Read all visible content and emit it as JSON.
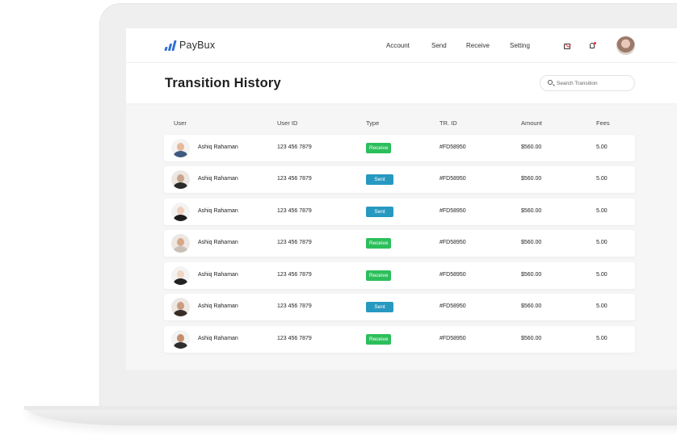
{
  "app": {
    "name": "PayBux",
    "nav": {
      "account": "Account",
      "send": "Send",
      "receive": "Receive",
      "setting": "Setting"
    },
    "icons": [
      "bar-chart-logo-icon",
      "mail-icon",
      "bell-icon"
    ]
  },
  "page": {
    "title": "Transition History",
    "search_placeholder": "Search Transition"
  },
  "table": {
    "columns": [
      "User",
      "User ID",
      "Type",
      "TR. ID",
      "Amount",
      "Fees"
    ],
    "rows": [
      {
        "user": "Ashiq Rahaman",
        "user_id": "123 456 7879",
        "type": "Receive",
        "tr_id": "#FD58950",
        "amount": "$560.00",
        "fees": "5.00"
      },
      {
        "user": "Ashiq Rahaman",
        "user_id": "123 456 7879",
        "type": "Sent",
        "tr_id": "#FD58950",
        "amount": "$560.00",
        "fees": "5.00"
      },
      {
        "user": "Ashiq Rahaman",
        "user_id": "123 456 7879",
        "type": "Sent",
        "tr_id": "#FD58950",
        "amount": "$560.00",
        "fees": "5.00"
      },
      {
        "user": "Ashiq Rahaman",
        "user_id": "123 456 7879",
        "type": "Receive",
        "tr_id": "#FD58950",
        "amount": "$560.00",
        "fees": "5.00"
      },
      {
        "user": "Ashiq Rahaman",
        "user_id": "123 456 7879",
        "type": "Receive",
        "tr_id": "#FD58950",
        "amount": "$560.00",
        "fees": "5.00"
      },
      {
        "user": "Ashiq Rahaman",
        "user_id": "123 456 7879",
        "type": "Sent",
        "tr_id": "#FD58950",
        "amount": "$560.00",
        "fees": "5.00"
      },
      {
        "user": "Ashiq Rahaman",
        "user_id": "123 456 7879",
        "type": "Receive",
        "tr_id": "#FD58950",
        "amount": "$560.00",
        "fees": "5.00"
      }
    ]
  },
  "colors": {
    "brand": "#2f6fd6",
    "receive_badge": "#2bbf5b",
    "sent_badge": "#2799c0"
  }
}
